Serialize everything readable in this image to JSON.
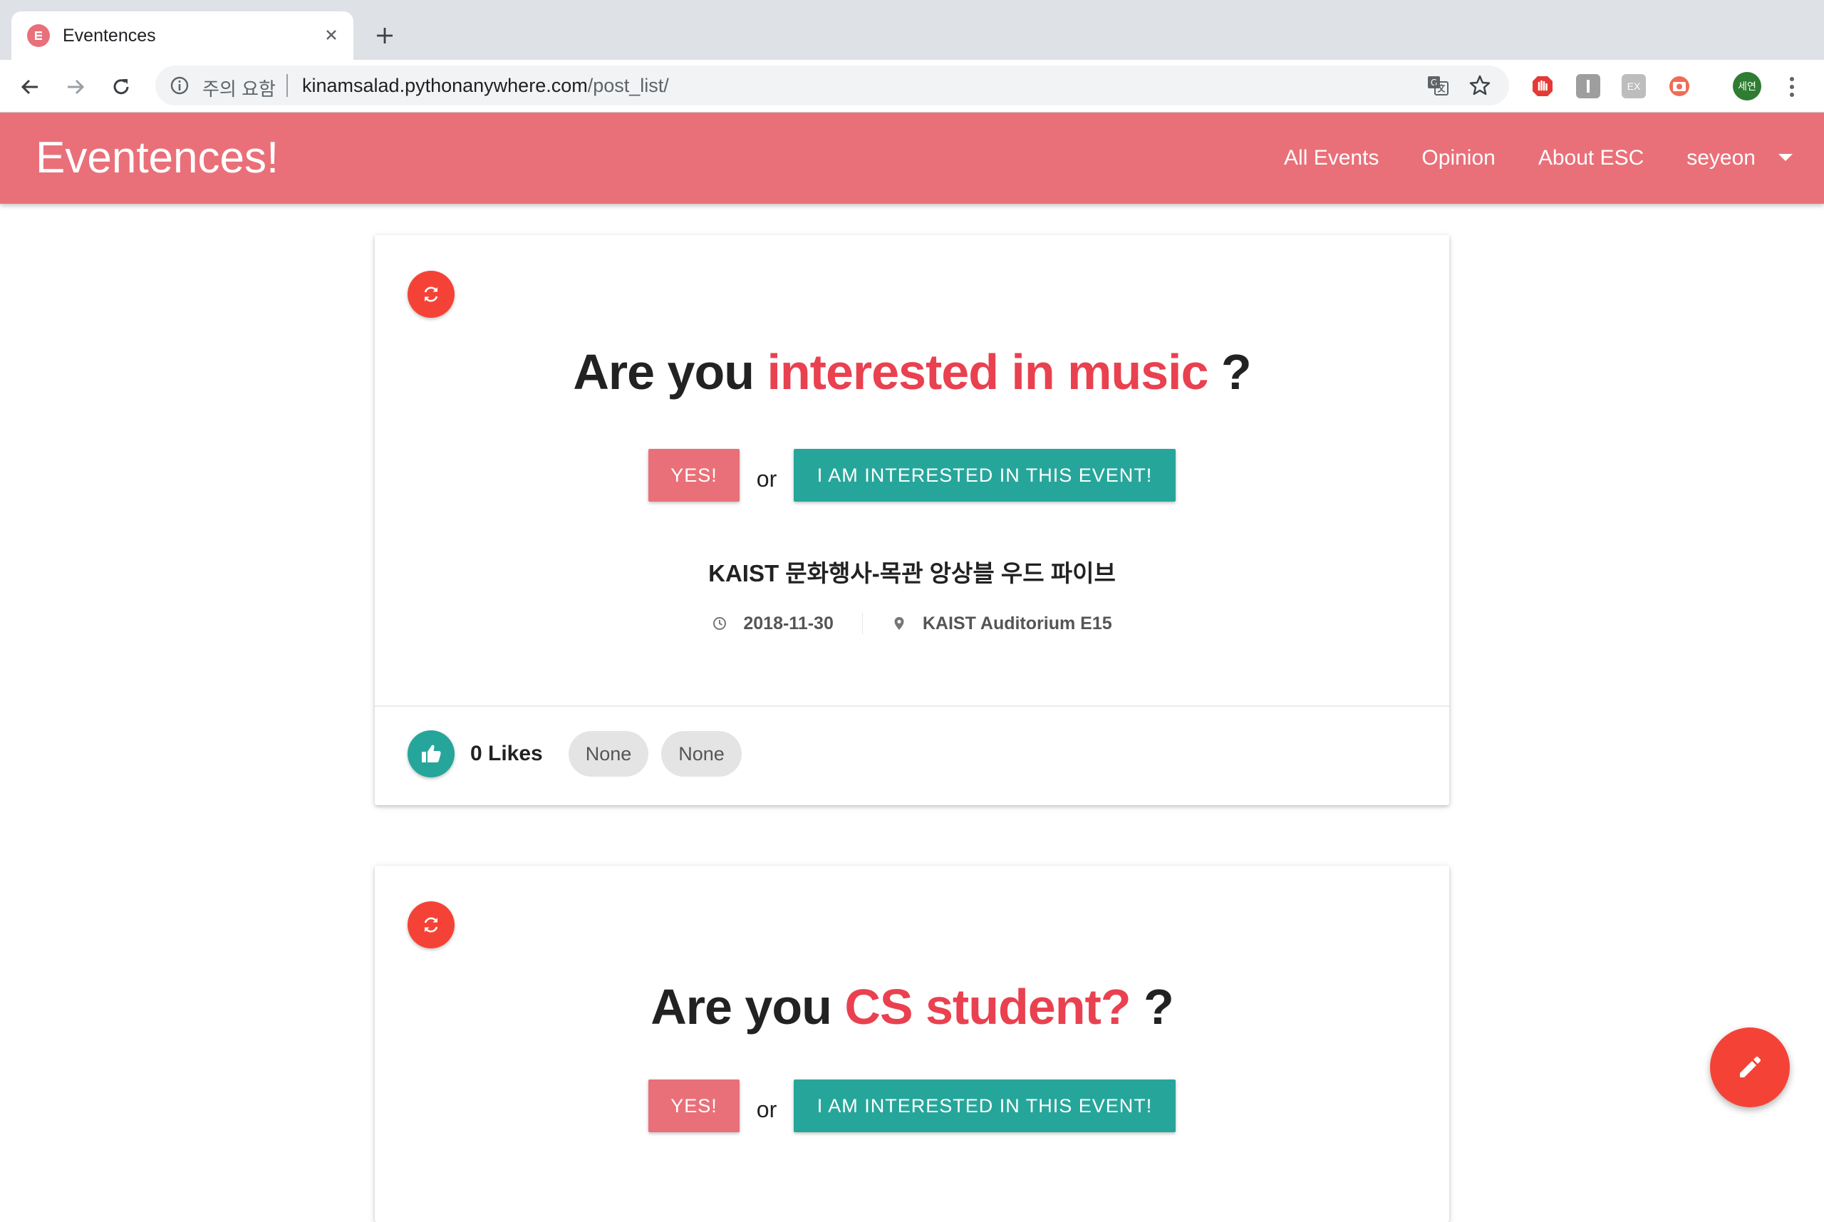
{
  "browser": {
    "tab_title": "Eventences",
    "security_label": "주의 요함",
    "url_host": "kinamsalad.pythonanywhere.com",
    "url_path": "/post_list/",
    "profile_label": "세연",
    "extension_ex_label": "EX"
  },
  "navbar": {
    "brand": "Eventences!",
    "links": [
      "All Events",
      "Opinion",
      "About ESC"
    ],
    "user": "seyeon"
  },
  "cards": [
    {
      "question_prefix": "Are you",
      "question_highlight": "interested in music",
      "question_suffix": "?",
      "yes_label": "YES!",
      "or_label": "or",
      "interest_label": "I AM INTERESTED IN THIS EVENT!",
      "event_title": "KAIST 문화행사-목관 앙상블 우드 파이브",
      "date": "2018-11-30",
      "location": "KAIST Auditorium E15",
      "likes": "0 Likes",
      "chips": [
        "None",
        "None"
      ]
    },
    {
      "question_prefix": "Are you",
      "question_highlight": "CS student?",
      "question_suffix": "?",
      "yes_label": "YES!",
      "or_label": "or",
      "interest_label": "I AM INTERESTED IN THIS EVENT!"
    }
  ],
  "colors": {
    "brand": "#e97079",
    "highlight": "#e9414f",
    "accent_teal": "#26a69a",
    "fab_red": "#f44336"
  },
  "icons": {
    "refresh": "refresh-icon",
    "like": "thumb-up-icon",
    "clock": "clock-icon",
    "location": "location-pin-icon",
    "fab": "pencil-icon"
  }
}
